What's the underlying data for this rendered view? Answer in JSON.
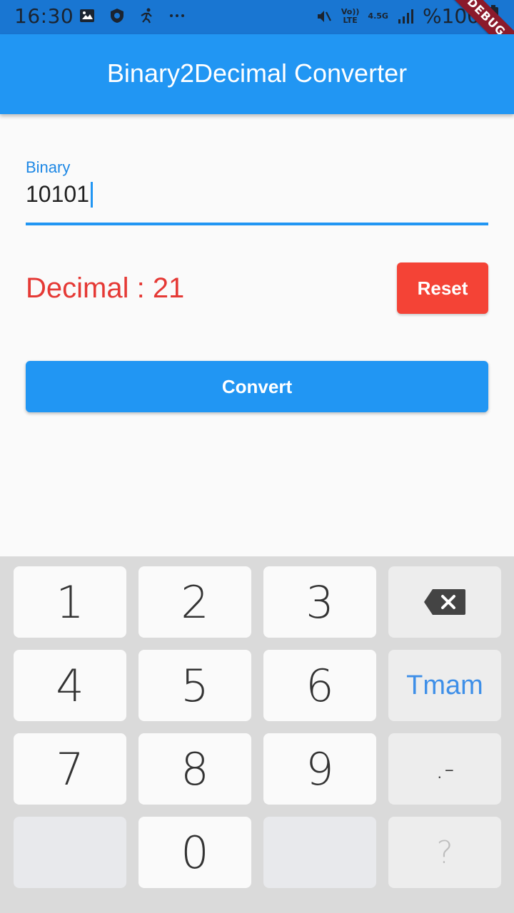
{
  "status_bar": {
    "time": "16:30",
    "lte_top": "Vo))",
    "lte_bottom": "LTE",
    "network_type": "4.5G",
    "battery_text": "%100",
    "icons": [
      "gallery-icon",
      "shield-icon",
      "runner-icon",
      "more-icon",
      "mute-icon",
      "signal-icon",
      "battery-icon"
    ]
  },
  "debug_banner": "DEBUG",
  "app_bar": {
    "title": "Binary2Decimal Converter"
  },
  "binary_input": {
    "label": "Binary",
    "value": "10101"
  },
  "decimal_result": "Decimal : 21",
  "reset_label": "Reset",
  "convert_label": "Convert",
  "keyboard": {
    "rows": [
      [
        "1",
        "2",
        "3",
        "backspace-icon"
      ],
      [
        "4",
        "5",
        "6",
        "Tmam"
      ],
      [
        "7",
        "8",
        "9",
        ".-"
      ],
      [
        "",
        "0",
        "",
        "?"
      ]
    ],
    "done_label": "Tmam",
    "punct_label": ".-",
    "question_label": "?"
  },
  "colors": {
    "primary": "#2196f3",
    "status_bar": "#1976d2",
    "accent_red": "#f44336",
    "result_red": "#e53935",
    "keyboard_bg": "#dadada"
  }
}
